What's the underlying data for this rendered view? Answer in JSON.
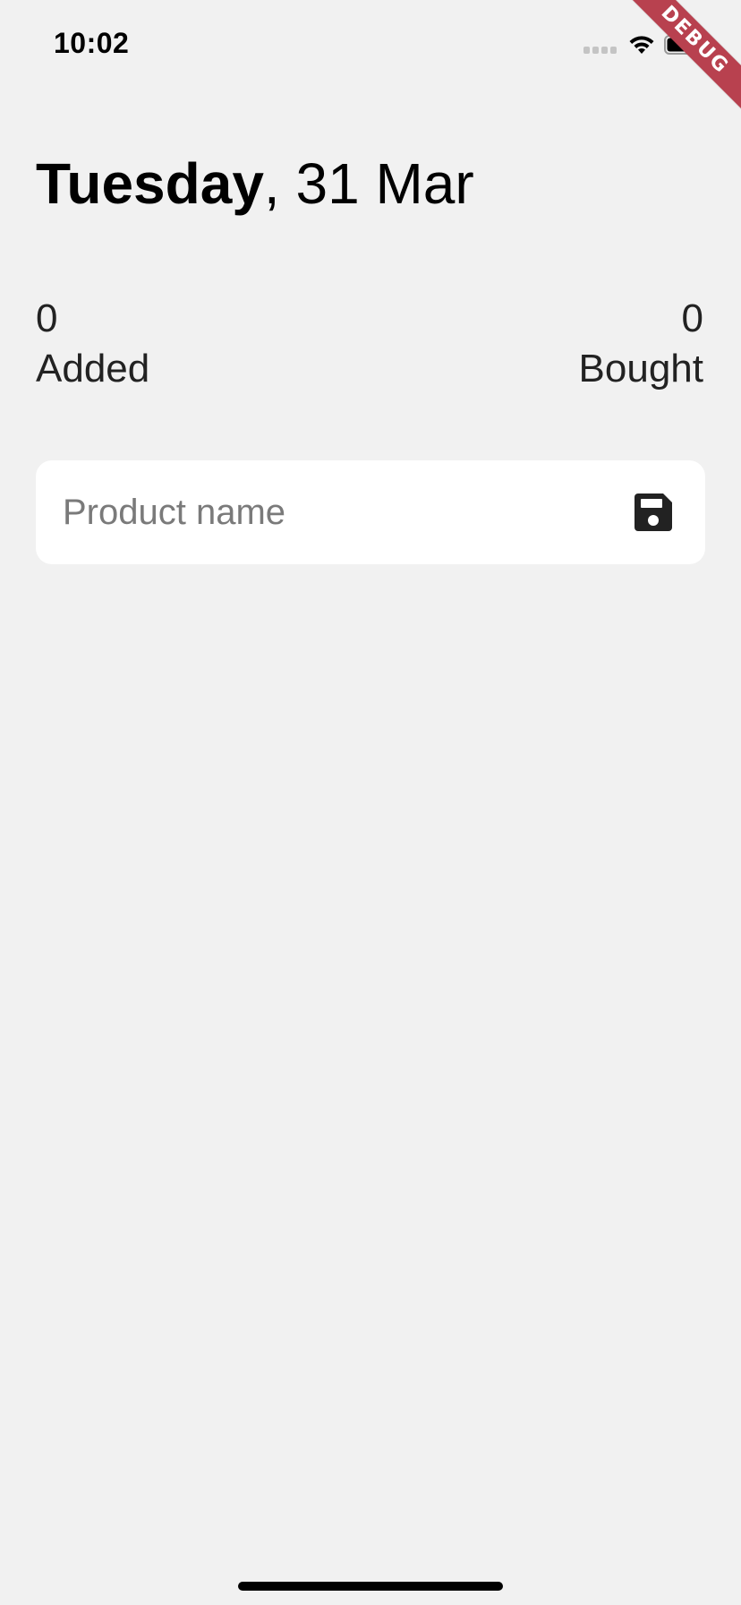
{
  "status_bar": {
    "time": "10:02",
    "icons": [
      "signal-icon",
      "wifi-icon",
      "battery-icon"
    ]
  },
  "debug_banner": {
    "label": "DEBUG",
    "color": "#b8414f"
  },
  "header": {
    "weekday": "Tuesday",
    "date_rest": ", 31 Mar"
  },
  "stats": {
    "added": {
      "count": "0",
      "label": "Added"
    },
    "bought": {
      "count": "0",
      "label": "Bought"
    }
  },
  "product_input": {
    "value": "",
    "placeholder": "Product name",
    "action_icon": "save-icon"
  },
  "colors": {
    "background": "#f1f1f1",
    "card": "#ffffff",
    "text": "#111111",
    "placeholder": "#7a7a7a"
  }
}
